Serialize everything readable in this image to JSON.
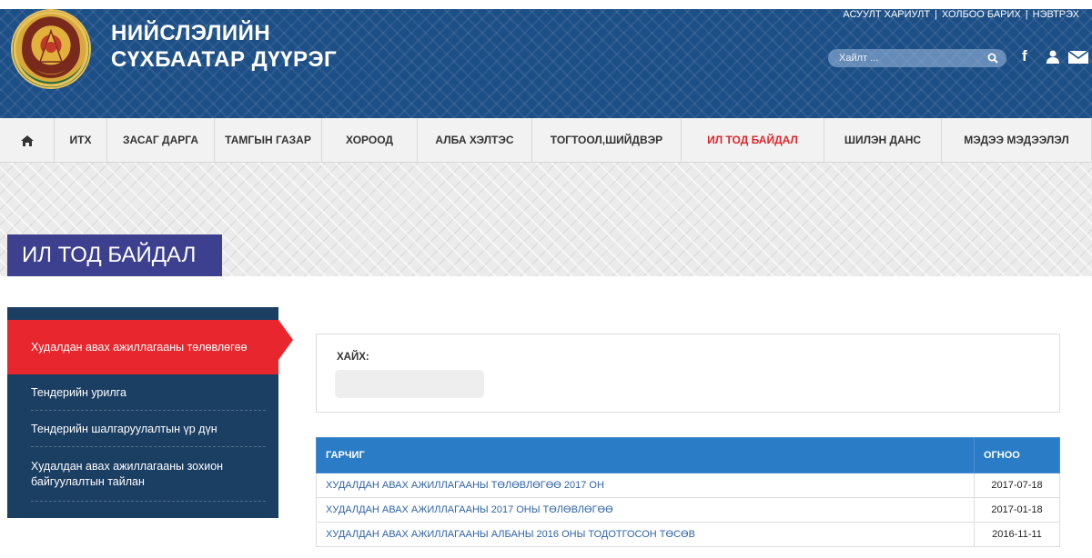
{
  "header": {
    "title_line1": "НИЙСЛЭЛИЙН",
    "title_line2": "СҮХБААТАР ДҮҮРЭГ",
    "top_links": [
      "АСУУЛТ ХАРИУЛТ",
      "ХОЛБОО БАРИХ",
      "НЭВТРЭХ"
    ],
    "search_placeholder": "Хайлт ...",
    "social_icons": [
      "facebook-icon",
      "user-icon",
      "mail-icon"
    ],
    "logo_icon": "district-emblem-icon"
  },
  "nav": {
    "home_icon": "home-icon",
    "items": [
      "ИТХ",
      "ЗАСАГ ДАРГА",
      "ТАМГЫН ГАЗАР",
      "ХОРООД",
      "АЛБА ХЭЛТЭС",
      "ТОГТООЛ,ШИЙДВЭР",
      "ИЛ ТОД БАЙДАЛ",
      "ШИЛЭН ДАНС",
      "МЭДЭЭ МЭДЭЭЛЭЛ"
    ],
    "active_item": "ИЛ ТОД БАЙДАЛ"
  },
  "page": {
    "title": "ИЛ ТОД БАЙДАЛ"
  },
  "sidebar": {
    "items": [
      {
        "label": "Худалдан авах ажиллагааны төлөвлөгөө",
        "active": true
      },
      {
        "label": "Тендерийн урилга",
        "active": false
      },
      {
        "label": "Тендерийн шалгаруулалтын үр дүн",
        "active": false
      },
      {
        "label": "Худалдан авах ажиллагааны зохион байгуулалтын тайлан",
        "active": false
      }
    ]
  },
  "filter": {
    "label": "ХАЙХ:",
    "value": ""
  },
  "table": {
    "headers": [
      "ГАРЧИГ",
      "ОГНОО"
    ],
    "rows": [
      {
        "title": "ХУДАЛДАН АВАХ АЖИЛЛАГААНЫ ТӨЛӨВЛӨГӨӨ 2017 ОН",
        "date": "2017-07-18"
      },
      {
        "title": "ХУДАЛДАН АВАХ АЖИЛЛАГААНЫ 2017 ОНЫ ТӨЛӨВЛӨГӨӨ",
        "date": "2017-01-18"
      },
      {
        "title": "ХУДАЛДАН АВАХ АЖИЛЛАГААНЫ АЛБАНЫ 2016 ОНЫ ТОДОТГОСОН ТӨСӨВ",
        "date": "2016-11-11"
      }
    ]
  },
  "colors": {
    "header_bg": "#1d4f87",
    "accent_red": "#e8262d",
    "sidebar_bg": "#1b3e63",
    "page_title_bg": "#3d3f8f",
    "table_head_bg": "#2a7cc7",
    "link_color": "#2f63a6"
  }
}
